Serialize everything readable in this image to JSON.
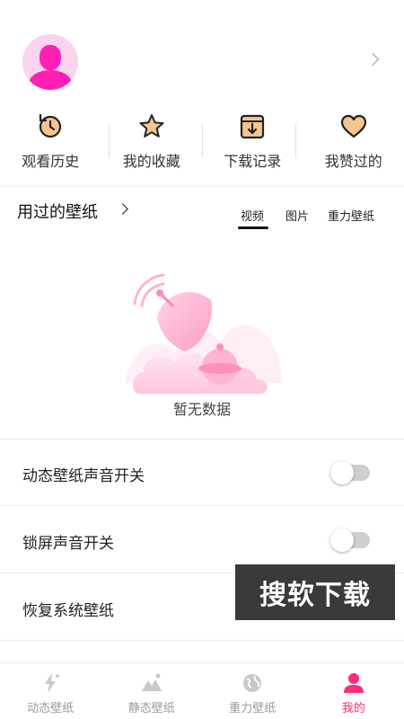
{
  "profile": {
    "avatar": "avatar-placeholder",
    "arrow": "chevron-right-icon"
  },
  "quick_actions": [
    {
      "label": "观看历史",
      "icon": "history-icon"
    },
    {
      "label": "我的收藏",
      "icon": "star-icon"
    },
    {
      "label": "下载记录",
      "icon": "download-box-icon"
    },
    {
      "label": "我赞过的",
      "icon": "heart-icon"
    }
  ],
  "used_wallpapers": {
    "title": "用过的壁纸",
    "tabs": [
      {
        "label": "视频",
        "active": true
      },
      {
        "label": "图片",
        "active": false
      },
      {
        "label": "重力壁纸",
        "active": false
      }
    ],
    "empty_text": "暂无数据"
  },
  "settings": [
    {
      "label": "动态壁纸声音开关",
      "toggle": false
    },
    {
      "label": "锁屏声音开关",
      "toggle": false
    },
    {
      "label": "恢复系统壁纸"
    }
  ],
  "watermark": "搜软下载",
  "bottom_nav": [
    {
      "label": "动态壁纸",
      "icon": "dynamic-wallpaper-icon",
      "active": false
    },
    {
      "label": "静态壁纸",
      "icon": "mountain-icon",
      "active": false
    },
    {
      "label": "重力壁纸",
      "icon": "globe-icon",
      "active": false
    },
    {
      "label": "我的",
      "icon": "person-icon",
      "active": true
    }
  ],
  "colors": {
    "accent": "#ff2b7a",
    "icon_fill": "#f3c690",
    "avatar_bg": "#fbd3ee",
    "avatar_fg": "#ff1fb2"
  }
}
